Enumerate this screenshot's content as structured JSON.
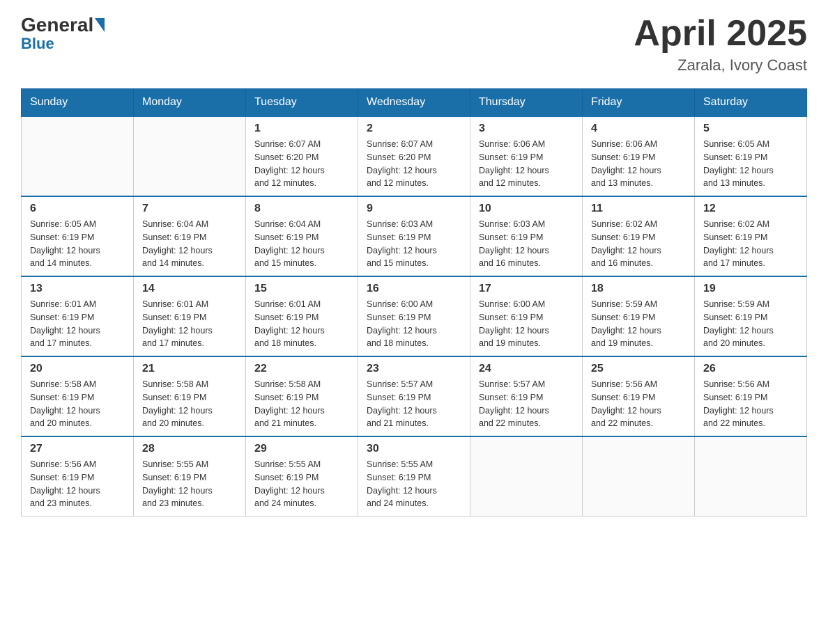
{
  "header": {
    "logo": {
      "general": "General",
      "blue": "Blue"
    },
    "title": "April 2025",
    "location": "Zarala, Ivory Coast"
  },
  "weekdays": [
    "Sunday",
    "Monday",
    "Tuesday",
    "Wednesday",
    "Thursday",
    "Friday",
    "Saturday"
  ],
  "weeks": [
    [
      {
        "day": "",
        "info": ""
      },
      {
        "day": "",
        "info": ""
      },
      {
        "day": "1",
        "info": "Sunrise: 6:07 AM\nSunset: 6:20 PM\nDaylight: 12 hours\nand 12 minutes."
      },
      {
        "day": "2",
        "info": "Sunrise: 6:07 AM\nSunset: 6:20 PM\nDaylight: 12 hours\nand 12 minutes."
      },
      {
        "day": "3",
        "info": "Sunrise: 6:06 AM\nSunset: 6:19 PM\nDaylight: 12 hours\nand 12 minutes."
      },
      {
        "day": "4",
        "info": "Sunrise: 6:06 AM\nSunset: 6:19 PM\nDaylight: 12 hours\nand 13 minutes."
      },
      {
        "day": "5",
        "info": "Sunrise: 6:05 AM\nSunset: 6:19 PM\nDaylight: 12 hours\nand 13 minutes."
      }
    ],
    [
      {
        "day": "6",
        "info": "Sunrise: 6:05 AM\nSunset: 6:19 PM\nDaylight: 12 hours\nand 14 minutes."
      },
      {
        "day": "7",
        "info": "Sunrise: 6:04 AM\nSunset: 6:19 PM\nDaylight: 12 hours\nand 14 minutes."
      },
      {
        "day": "8",
        "info": "Sunrise: 6:04 AM\nSunset: 6:19 PM\nDaylight: 12 hours\nand 15 minutes."
      },
      {
        "day": "9",
        "info": "Sunrise: 6:03 AM\nSunset: 6:19 PM\nDaylight: 12 hours\nand 15 minutes."
      },
      {
        "day": "10",
        "info": "Sunrise: 6:03 AM\nSunset: 6:19 PM\nDaylight: 12 hours\nand 16 minutes."
      },
      {
        "day": "11",
        "info": "Sunrise: 6:02 AM\nSunset: 6:19 PM\nDaylight: 12 hours\nand 16 minutes."
      },
      {
        "day": "12",
        "info": "Sunrise: 6:02 AM\nSunset: 6:19 PM\nDaylight: 12 hours\nand 17 minutes."
      }
    ],
    [
      {
        "day": "13",
        "info": "Sunrise: 6:01 AM\nSunset: 6:19 PM\nDaylight: 12 hours\nand 17 minutes."
      },
      {
        "day": "14",
        "info": "Sunrise: 6:01 AM\nSunset: 6:19 PM\nDaylight: 12 hours\nand 17 minutes."
      },
      {
        "day": "15",
        "info": "Sunrise: 6:01 AM\nSunset: 6:19 PM\nDaylight: 12 hours\nand 18 minutes."
      },
      {
        "day": "16",
        "info": "Sunrise: 6:00 AM\nSunset: 6:19 PM\nDaylight: 12 hours\nand 18 minutes."
      },
      {
        "day": "17",
        "info": "Sunrise: 6:00 AM\nSunset: 6:19 PM\nDaylight: 12 hours\nand 19 minutes."
      },
      {
        "day": "18",
        "info": "Sunrise: 5:59 AM\nSunset: 6:19 PM\nDaylight: 12 hours\nand 19 minutes."
      },
      {
        "day": "19",
        "info": "Sunrise: 5:59 AM\nSunset: 6:19 PM\nDaylight: 12 hours\nand 20 minutes."
      }
    ],
    [
      {
        "day": "20",
        "info": "Sunrise: 5:58 AM\nSunset: 6:19 PM\nDaylight: 12 hours\nand 20 minutes."
      },
      {
        "day": "21",
        "info": "Sunrise: 5:58 AM\nSunset: 6:19 PM\nDaylight: 12 hours\nand 20 minutes."
      },
      {
        "day": "22",
        "info": "Sunrise: 5:58 AM\nSunset: 6:19 PM\nDaylight: 12 hours\nand 21 minutes."
      },
      {
        "day": "23",
        "info": "Sunrise: 5:57 AM\nSunset: 6:19 PM\nDaylight: 12 hours\nand 21 minutes."
      },
      {
        "day": "24",
        "info": "Sunrise: 5:57 AM\nSunset: 6:19 PM\nDaylight: 12 hours\nand 22 minutes."
      },
      {
        "day": "25",
        "info": "Sunrise: 5:56 AM\nSunset: 6:19 PM\nDaylight: 12 hours\nand 22 minutes."
      },
      {
        "day": "26",
        "info": "Sunrise: 5:56 AM\nSunset: 6:19 PM\nDaylight: 12 hours\nand 22 minutes."
      }
    ],
    [
      {
        "day": "27",
        "info": "Sunrise: 5:56 AM\nSunset: 6:19 PM\nDaylight: 12 hours\nand 23 minutes."
      },
      {
        "day": "28",
        "info": "Sunrise: 5:55 AM\nSunset: 6:19 PM\nDaylight: 12 hours\nand 23 minutes."
      },
      {
        "day": "29",
        "info": "Sunrise: 5:55 AM\nSunset: 6:19 PM\nDaylight: 12 hours\nand 24 minutes."
      },
      {
        "day": "30",
        "info": "Sunrise: 5:55 AM\nSunset: 6:19 PM\nDaylight: 12 hours\nand 24 minutes."
      },
      {
        "day": "",
        "info": ""
      },
      {
        "day": "",
        "info": ""
      },
      {
        "day": "",
        "info": ""
      }
    ]
  ]
}
